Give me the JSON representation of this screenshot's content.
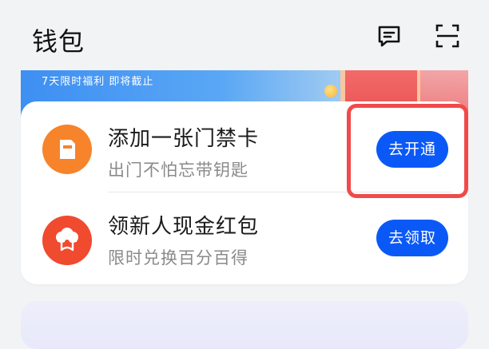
{
  "header": {
    "title": "钱包",
    "icons": [
      "message-icon",
      "scan-icon"
    ]
  },
  "banner": {
    "text": "7天限时福利 即将截止"
  },
  "items": [
    {
      "title": "添加一张门禁卡",
      "subtitle": "出门不怕忘带钥匙",
      "action": "去开通",
      "icon": "access-card-icon",
      "icon_color": "#f7842a"
    },
    {
      "title": "领新人现金红包",
      "subtitle": "限时兑换百分百得",
      "action": "去领取",
      "icon": "red-packet-icon",
      "icon_color": "#f04a2f"
    }
  ],
  "colors": {
    "accent": "#0a59f7",
    "highlight": "#f04a4a"
  }
}
